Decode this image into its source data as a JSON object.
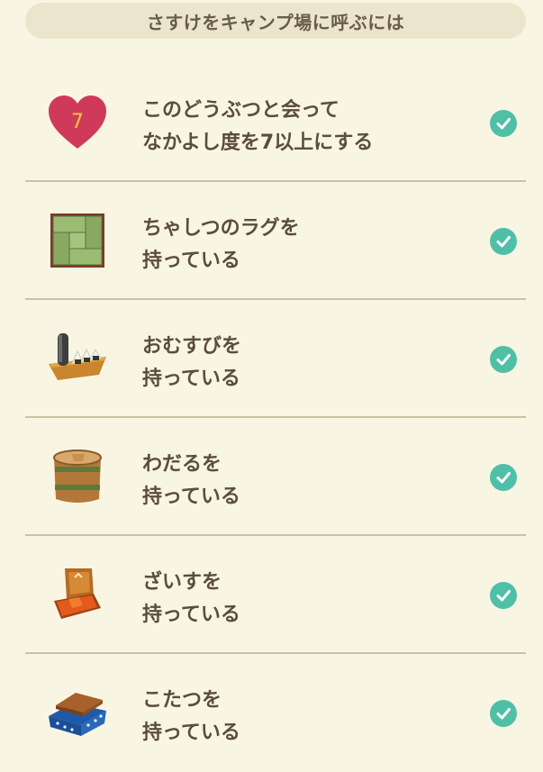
{
  "header": {
    "title": "さすけをキャンプ場に呼ぶには"
  },
  "items": [
    {
      "icon": "heart-friendship-icon",
      "heart_number": "7",
      "line1": "このどうぶつと会って",
      "line2": "なかよし度を7以上にする",
      "done": true
    },
    {
      "icon": "tatami-rug-icon",
      "line1": "ちゃしつのラグを",
      "line2": "持っている",
      "done": true
    },
    {
      "icon": "rice-ball-platter-icon",
      "line1": "おむすびを",
      "line2": "持っている",
      "done": true
    },
    {
      "icon": "wooden-tub-icon",
      "line1": "わだるを",
      "line2": "持っている",
      "done": true
    },
    {
      "icon": "floor-chair-icon",
      "line1": "ざいすを",
      "line2": "持っている",
      "done": true
    },
    {
      "icon": "kotatsu-icon",
      "line1": "こたつを",
      "line2": "持っている",
      "done": true
    }
  ],
  "colors": {
    "background": "#f9f5e3",
    "header_bg": "#ece5cd",
    "check": "#4fbfa8",
    "text": "#5b4d3e"
  }
}
